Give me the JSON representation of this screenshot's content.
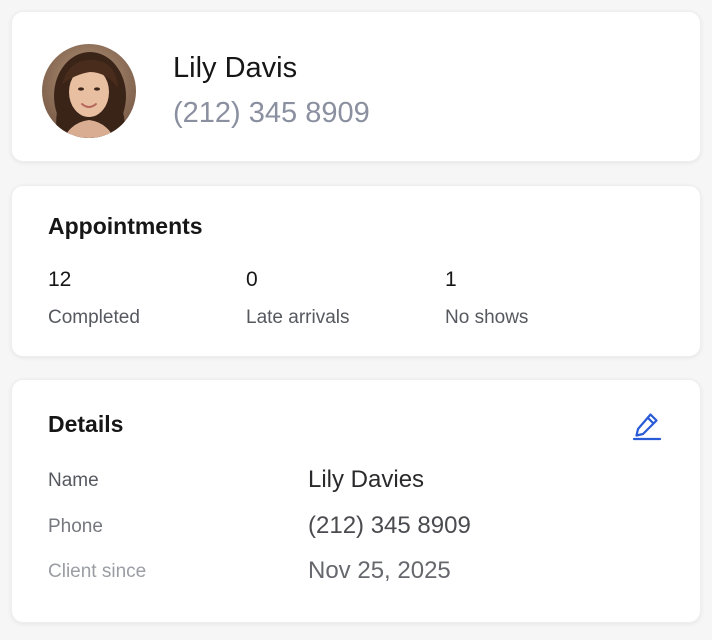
{
  "profile": {
    "name": "Lily Davis",
    "phone": "(212) 345 8909"
  },
  "appointments": {
    "title": "Appointments",
    "stats": [
      {
        "value": "12",
        "label": "Completed"
      },
      {
        "value": "0",
        "label": "Late arrivals"
      },
      {
        "value": "1",
        "label": "No shows"
      }
    ]
  },
  "details": {
    "title": "Details",
    "rows": [
      {
        "label": "Name",
        "value": "Lily Davies"
      },
      {
        "label": "Phone",
        "value": "(212) 345 8909"
      },
      {
        "label": "Client since",
        "value": "Nov 25, 2025"
      }
    ]
  },
  "colors": {
    "accent": "#2a5bd7",
    "muted_text": "#8b90a0"
  },
  "icons": {
    "edit": "pencil-icon"
  }
}
